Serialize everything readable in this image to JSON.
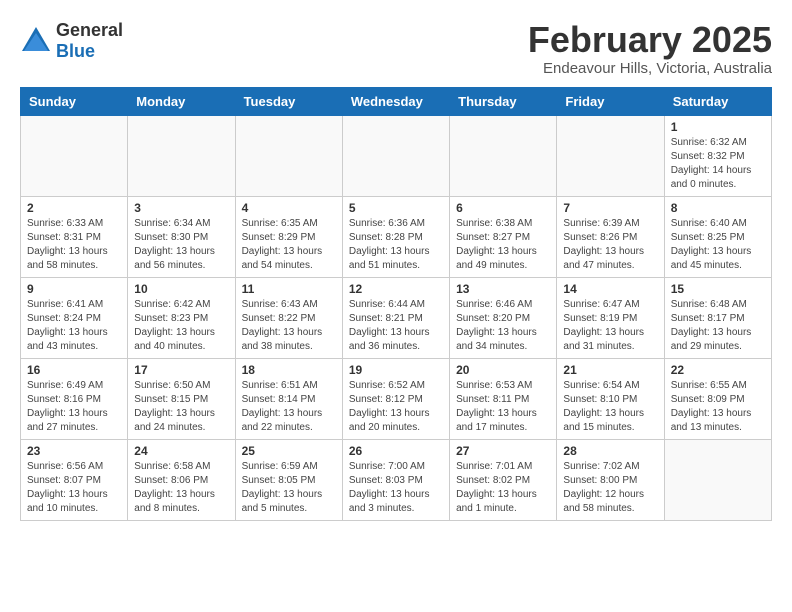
{
  "logo": {
    "general": "General",
    "blue": "Blue"
  },
  "title": "February 2025",
  "subtitle": "Endeavour Hills, Victoria, Australia",
  "days_of_week": [
    "Sunday",
    "Monday",
    "Tuesday",
    "Wednesday",
    "Thursday",
    "Friday",
    "Saturday"
  ],
  "weeks": [
    [
      {
        "day": "",
        "info": ""
      },
      {
        "day": "",
        "info": ""
      },
      {
        "day": "",
        "info": ""
      },
      {
        "day": "",
        "info": ""
      },
      {
        "day": "",
        "info": ""
      },
      {
        "day": "",
        "info": ""
      },
      {
        "day": "1",
        "info": "Sunrise: 6:32 AM\nSunset: 8:32 PM\nDaylight: 14 hours\nand 0 minutes."
      }
    ],
    [
      {
        "day": "2",
        "info": "Sunrise: 6:33 AM\nSunset: 8:31 PM\nDaylight: 13 hours\nand 58 minutes."
      },
      {
        "day": "3",
        "info": "Sunrise: 6:34 AM\nSunset: 8:30 PM\nDaylight: 13 hours\nand 56 minutes."
      },
      {
        "day": "4",
        "info": "Sunrise: 6:35 AM\nSunset: 8:29 PM\nDaylight: 13 hours\nand 54 minutes."
      },
      {
        "day": "5",
        "info": "Sunrise: 6:36 AM\nSunset: 8:28 PM\nDaylight: 13 hours\nand 51 minutes."
      },
      {
        "day": "6",
        "info": "Sunrise: 6:38 AM\nSunset: 8:27 PM\nDaylight: 13 hours\nand 49 minutes."
      },
      {
        "day": "7",
        "info": "Sunrise: 6:39 AM\nSunset: 8:26 PM\nDaylight: 13 hours\nand 47 minutes."
      },
      {
        "day": "8",
        "info": "Sunrise: 6:40 AM\nSunset: 8:25 PM\nDaylight: 13 hours\nand 45 minutes."
      }
    ],
    [
      {
        "day": "9",
        "info": "Sunrise: 6:41 AM\nSunset: 8:24 PM\nDaylight: 13 hours\nand 43 minutes."
      },
      {
        "day": "10",
        "info": "Sunrise: 6:42 AM\nSunset: 8:23 PM\nDaylight: 13 hours\nand 40 minutes."
      },
      {
        "day": "11",
        "info": "Sunrise: 6:43 AM\nSunset: 8:22 PM\nDaylight: 13 hours\nand 38 minutes."
      },
      {
        "day": "12",
        "info": "Sunrise: 6:44 AM\nSunset: 8:21 PM\nDaylight: 13 hours\nand 36 minutes."
      },
      {
        "day": "13",
        "info": "Sunrise: 6:46 AM\nSunset: 8:20 PM\nDaylight: 13 hours\nand 34 minutes."
      },
      {
        "day": "14",
        "info": "Sunrise: 6:47 AM\nSunset: 8:19 PM\nDaylight: 13 hours\nand 31 minutes."
      },
      {
        "day": "15",
        "info": "Sunrise: 6:48 AM\nSunset: 8:17 PM\nDaylight: 13 hours\nand 29 minutes."
      }
    ],
    [
      {
        "day": "16",
        "info": "Sunrise: 6:49 AM\nSunset: 8:16 PM\nDaylight: 13 hours\nand 27 minutes."
      },
      {
        "day": "17",
        "info": "Sunrise: 6:50 AM\nSunset: 8:15 PM\nDaylight: 13 hours\nand 24 minutes."
      },
      {
        "day": "18",
        "info": "Sunrise: 6:51 AM\nSunset: 8:14 PM\nDaylight: 13 hours\nand 22 minutes."
      },
      {
        "day": "19",
        "info": "Sunrise: 6:52 AM\nSunset: 8:12 PM\nDaylight: 13 hours\nand 20 minutes."
      },
      {
        "day": "20",
        "info": "Sunrise: 6:53 AM\nSunset: 8:11 PM\nDaylight: 13 hours\nand 17 minutes."
      },
      {
        "day": "21",
        "info": "Sunrise: 6:54 AM\nSunset: 8:10 PM\nDaylight: 13 hours\nand 15 minutes."
      },
      {
        "day": "22",
        "info": "Sunrise: 6:55 AM\nSunset: 8:09 PM\nDaylight: 13 hours\nand 13 minutes."
      }
    ],
    [
      {
        "day": "23",
        "info": "Sunrise: 6:56 AM\nSunset: 8:07 PM\nDaylight: 13 hours\nand 10 minutes."
      },
      {
        "day": "24",
        "info": "Sunrise: 6:58 AM\nSunset: 8:06 PM\nDaylight: 13 hours\nand 8 minutes."
      },
      {
        "day": "25",
        "info": "Sunrise: 6:59 AM\nSunset: 8:05 PM\nDaylight: 13 hours\nand 5 minutes."
      },
      {
        "day": "26",
        "info": "Sunrise: 7:00 AM\nSunset: 8:03 PM\nDaylight: 13 hours\nand 3 minutes."
      },
      {
        "day": "27",
        "info": "Sunrise: 7:01 AM\nSunset: 8:02 PM\nDaylight: 13 hours\nand 1 minute."
      },
      {
        "day": "28",
        "info": "Sunrise: 7:02 AM\nSunset: 8:00 PM\nDaylight: 12 hours\nand 58 minutes."
      },
      {
        "day": "",
        "info": ""
      }
    ]
  ]
}
